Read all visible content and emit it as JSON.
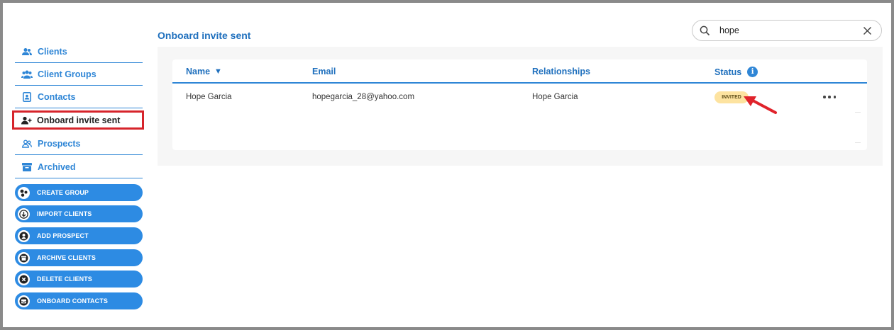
{
  "sidebar": {
    "nav": [
      {
        "label": "Clients",
        "icon": "clients-icon"
      },
      {
        "label": "Client Groups",
        "icon": "client-groups-icon"
      },
      {
        "label": "Contacts",
        "icon": "contacts-icon"
      },
      {
        "label": "Onboard invite sent",
        "icon": "person-add-icon",
        "active": true
      },
      {
        "label": "Prospects",
        "icon": "prospects-icon"
      },
      {
        "label": "Archived",
        "icon": "archive-icon"
      }
    ],
    "actions": [
      {
        "label": "CREATE GROUP",
        "icon": "group-icon"
      },
      {
        "label": "IMPORT CLIENTS",
        "icon": "import-icon"
      },
      {
        "label": "ADD PROSPECT",
        "icon": "person-icon"
      },
      {
        "label": "ARCHIVE CLIENTS",
        "icon": "archive-icon"
      },
      {
        "label": "DELETE CLIENTS",
        "icon": "close-icon"
      },
      {
        "label": "ONBOARD CONTACTS",
        "icon": "inbox-icon"
      }
    ]
  },
  "main": {
    "title": "Onboard invite sent",
    "search": {
      "value": "hope",
      "placeholder": ""
    },
    "table": {
      "columns": [
        "Name",
        "Email",
        "Relationships",
        "Status"
      ],
      "sort_indicator": "▼",
      "info_glyph": "i",
      "rows": [
        {
          "name": "Hope Garcia",
          "email": "hopegarcia_28@yahoo.com",
          "relationships": "Hope Garcia",
          "status": "INVITED"
        }
      ]
    }
  },
  "colors": {
    "accent": "#2f86d6",
    "title": "#1e6fbd",
    "highlight": "#d6242b",
    "badge": "#fde3a0"
  }
}
